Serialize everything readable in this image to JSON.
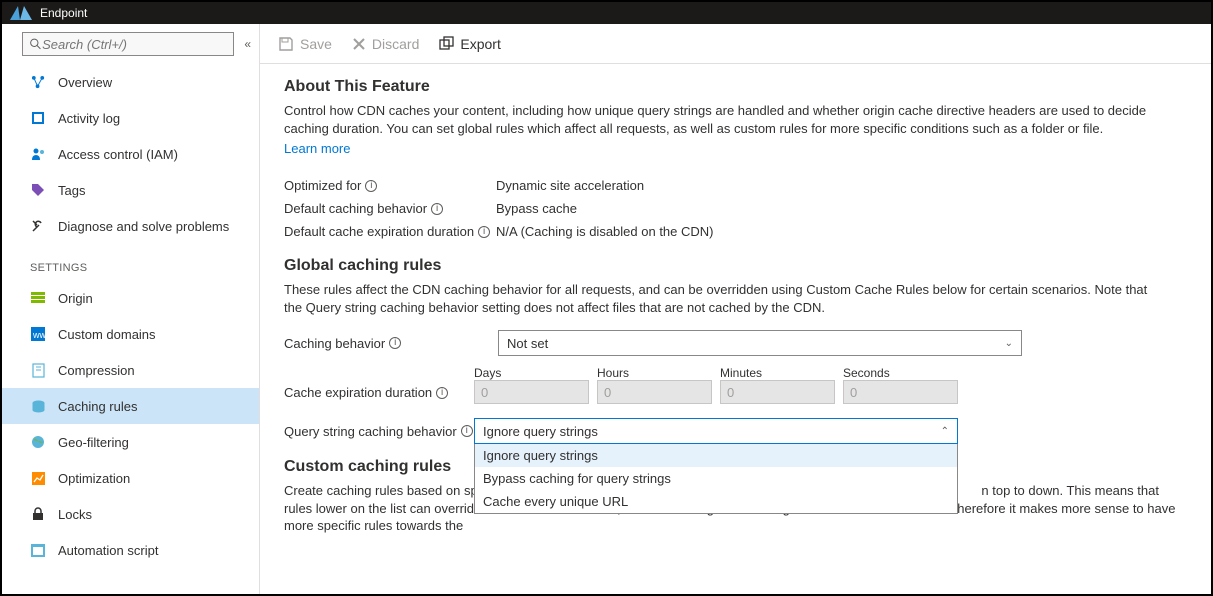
{
  "topbar": {
    "title": "Endpoint"
  },
  "search": {
    "placeholder": "Search (Ctrl+/)"
  },
  "nav": {
    "overview": "Overview",
    "activity_log": "Activity log",
    "access_control": "Access control (IAM)",
    "tags": "Tags",
    "diagnose": "Diagnose and solve problems",
    "settings_header": "SETTINGS",
    "origin": "Origin",
    "custom_domains": "Custom domains",
    "compression": "Compression",
    "caching_rules": "Caching rules",
    "geo_filtering": "Geo-filtering",
    "optimization": "Optimization",
    "locks": "Locks",
    "automation_script": "Automation script"
  },
  "toolbar": {
    "save": "Save",
    "discard": "Discard",
    "export": "Export"
  },
  "about": {
    "title": "About This Feature",
    "desc": "Control how CDN caches your content, including how unique query strings are handled and whether origin cache directive headers are used to decide caching duration. You can set global rules which affect all requests, as well as custom rules for more specific conditions such as a folder or file.",
    "learn_more": "Learn more",
    "optimized_label": "Optimized for",
    "optimized_value": "Dynamic site acceleration",
    "default_behavior_label": "Default caching behavior",
    "default_behavior_value": "Bypass cache",
    "default_expiration_label": "Default cache expiration duration",
    "default_expiration_value": "N/A (Caching is disabled on the CDN)"
  },
  "global_rules": {
    "title": "Global caching rules",
    "desc": "These rules affect the CDN caching behavior for all requests, and can be overridden using Custom Cache Rules below for certain scenarios. Note that the Query string caching behavior setting does not affect files that are not cached by the CDN.",
    "caching_behavior_label": "Caching behavior",
    "caching_behavior_value": "Not set",
    "expiration_label": "Cache expiration duration",
    "days": "Days",
    "hours": "Hours",
    "minutes": "Minutes",
    "seconds": "Seconds",
    "zero": "0",
    "query_label": "Query string caching behavior",
    "query_selected": "Ignore query strings",
    "query_options": {
      "opt1": "Ignore query strings",
      "opt2": "Bypass caching for query strings",
      "opt3": "Cache every unique URL"
    }
  },
  "custom_rules": {
    "title": "Custom caching rules",
    "desc_part1": "Create caching rules based on spec",
    "desc_part2": "n top to down. This means that rules lower on the list can override rules above it in the list, as well as the global caching rules and default behavior. Therefore it makes more sense to have more specific rules towards the"
  }
}
